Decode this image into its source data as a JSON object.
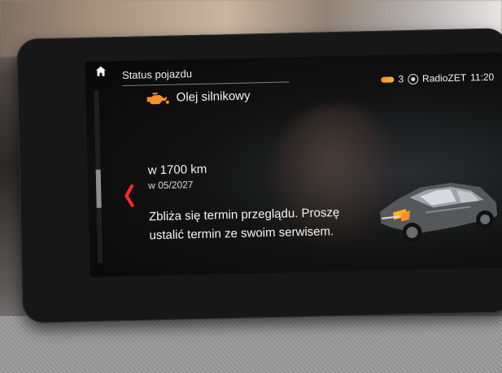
{
  "screen": {
    "title": "Status pojazdu",
    "item_title": "Olej silnikowy",
    "mileage": "w 1700 km",
    "date": "w 05/2027",
    "message_line_1": "Zbliża się termin przeglądu. Proszę",
    "message_line_2": "ustalić termin ze swoim serwisem."
  },
  "status_bar": {
    "notification_count": "3",
    "radio_station": "RadioZET",
    "time": "11:20"
  },
  "icons": {
    "home": "home-icon",
    "notification": "notification-indicator-icon",
    "radio": "radio-icon",
    "back": "chevron-left-icon",
    "oil": "oil-can-icon",
    "car": "car-icon"
  },
  "colors": {
    "accent_orange": "#ff8c26",
    "back_red": "#ff2a2a",
    "text_white": "#f3f3f3"
  }
}
